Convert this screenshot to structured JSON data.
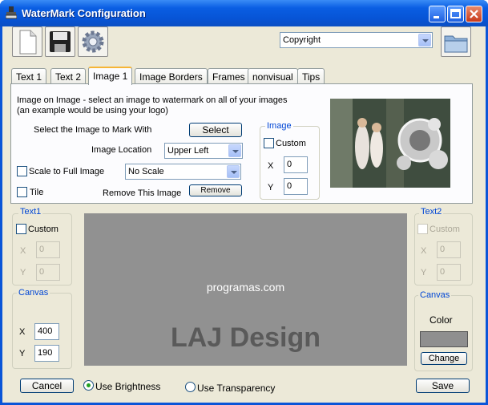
{
  "window": {
    "title": "WaterMark Configuration"
  },
  "toolbar": {
    "preset_value": "Copyright"
  },
  "tabs": [
    "Text 1",
    "Text 2",
    "Image 1",
    "Image Borders",
    "Frames",
    "nonvisual",
    "Tips"
  ],
  "image_tab": {
    "description_line1": "Image on Image - select an image to watermark on all of your images",
    "description_line2": "(an example would be using your logo)",
    "select_label": "Select the Image to Mark With",
    "select_button": "Select",
    "location_label": "Image Location",
    "location_value": "Upper Left",
    "scale_checkbox": "Scale to Full Image",
    "scale_value": "No Scale",
    "tile_checkbox": "Tile",
    "remove_label": "Remove This Image",
    "remove_button": "Remove",
    "image_group": {
      "title": "Image",
      "custom": "Custom",
      "x_label": "X",
      "x_value": "0",
      "y_label": "Y",
      "y_value": "0"
    }
  },
  "text1_group": {
    "title": "Text1",
    "custom": "Custom",
    "x_label": "X",
    "x_value": "0",
    "y_label": "Y",
    "y_value": "0"
  },
  "text2_group": {
    "title": "Text2",
    "custom": "Custom",
    "x_label": "X",
    "x_value": "0",
    "y_label": "Y",
    "y_value": "0"
  },
  "canvas_group": {
    "title": "Canvas",
    "x_label": "X",
    "x_value": "400",
    "y_label": "Y",
    "y_value": "190"
  },
  "canvas_color_group": {
    "title": "Canvas",
    "color_label": "Color",
    "change_button": "Change",
    "color": "#8f8f8f"
  },
  "preview": {
    "text1": "programas.com",
    "text2": "LAJ Design",
    "background": "#919191"
  },
  "footer": {
    "cancel_button": "Cancel",
    "brightness_radio": "Use Brightness",
    "transparency_radio": "Use Transparency",
    "save_button": "Save"
  }
}
